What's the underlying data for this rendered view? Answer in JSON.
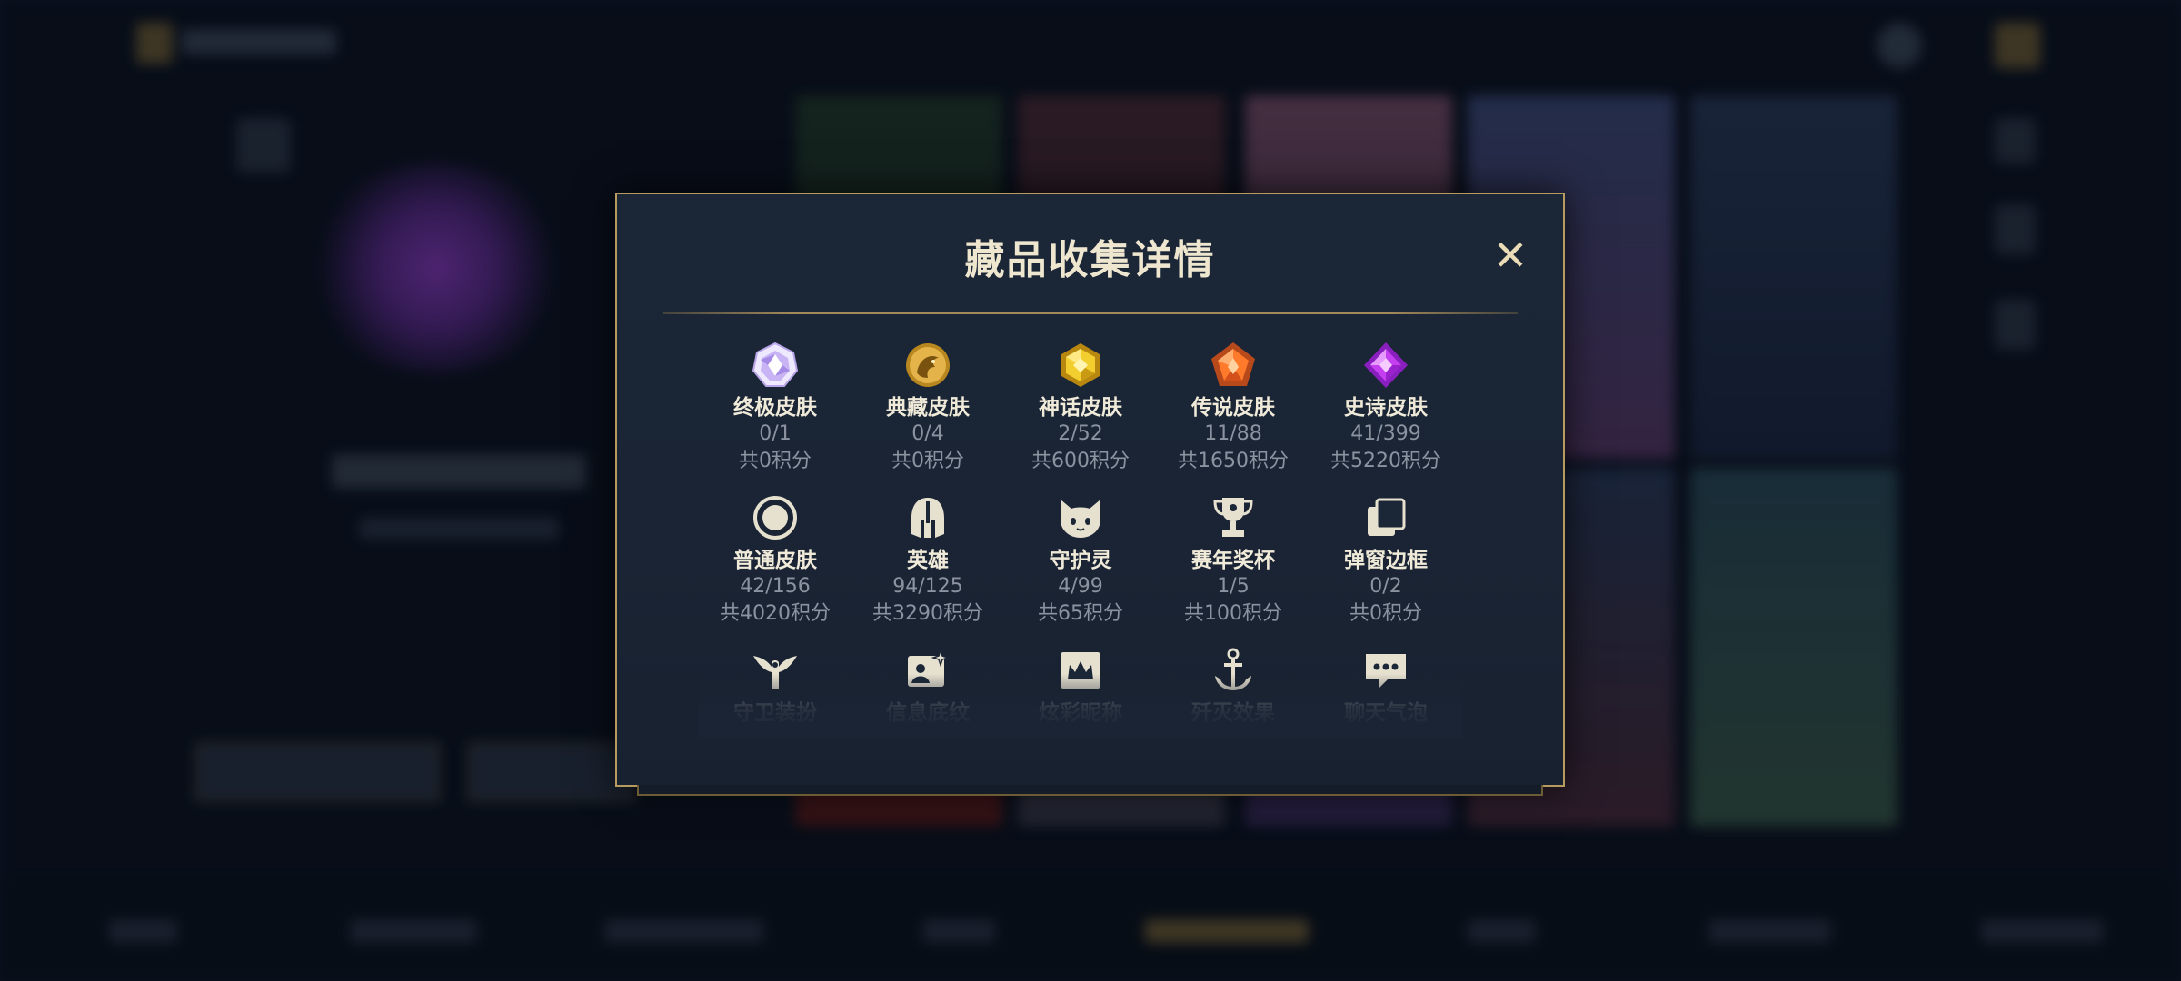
{
  "modal": {
    "title": "藏品收集详情",
    "close_label": "✕"
  },
  "colors": {
    "border": "#b69a5e",
    "panel": "#1b2636",
    "title": "#efe6cf",
    "muted": "#8b93a0"
  },
  "categories": [
    {
      "name": "终极皮肤",
      "count": "0/1",
      "points": "共0积分",
      "icon": "ultimate-skin-icon"
    },
    {
      "name": "典藏皮肤",
      "count": "0/4",
      "points": "共0积分",
      "icon": "collector-skin-icon"
    },
    {
      "name": "神话皮肤",
      "count": "2/52",
      "points": "共600积分",
      "icon": "mythic-skin-icon"
    },
    {
      "name": "传说皮肤",
      "count": "11/88",
      "points": "共1650积分",
      "icon": "legendary-skin-icon"
    },
    {
      "name": "史诗皮肤",
      "count": "41/399",
      "points": "共5220积分",
      "icon": "epic-skin-icon"
    },
    {
      "name": "普通皮肤",
      "count": "42/156",
      "points": "共4020积分",
      "icon": "normal-skin-icon"
    },
    {
      "name": "英雄",
      "count": "94/125",
      "points": "共3290积分",
      "icon": "hero-helmet-icon"
    },
    {
      "name": "守护灵",
      "count": "4/99",
      "points": "共65积分",
      "icon": "guardian-spirit-icon"
    },
    {
      "name": "赛年奖杯",
      "count": "1/5",
      "points": "共100积分",
      "icon": "trophy-icon"
    },
    {
      "name": "弹窗边框",
      "count": "0/2",
      "points": "共0积分",
      "icon": "popup-frame-icon"
    },
    {
      "name": "守卫装扮",
      "icon": "ward-skin-icon"
    },
    {
      "name": "信息底纹",
      "icon": "profile-background-icon"
    },
    {
      "name": "炫彩昵称",
      "icon": "colorful-nickname-icon"
    },
    {
      "name": "歼灭效果",
      "icon": "elimination-effect-icon"
    },
    {
      "name": "聊天气泡",
      "icon": "chat-bubble-icon"
    }
  ]
}
